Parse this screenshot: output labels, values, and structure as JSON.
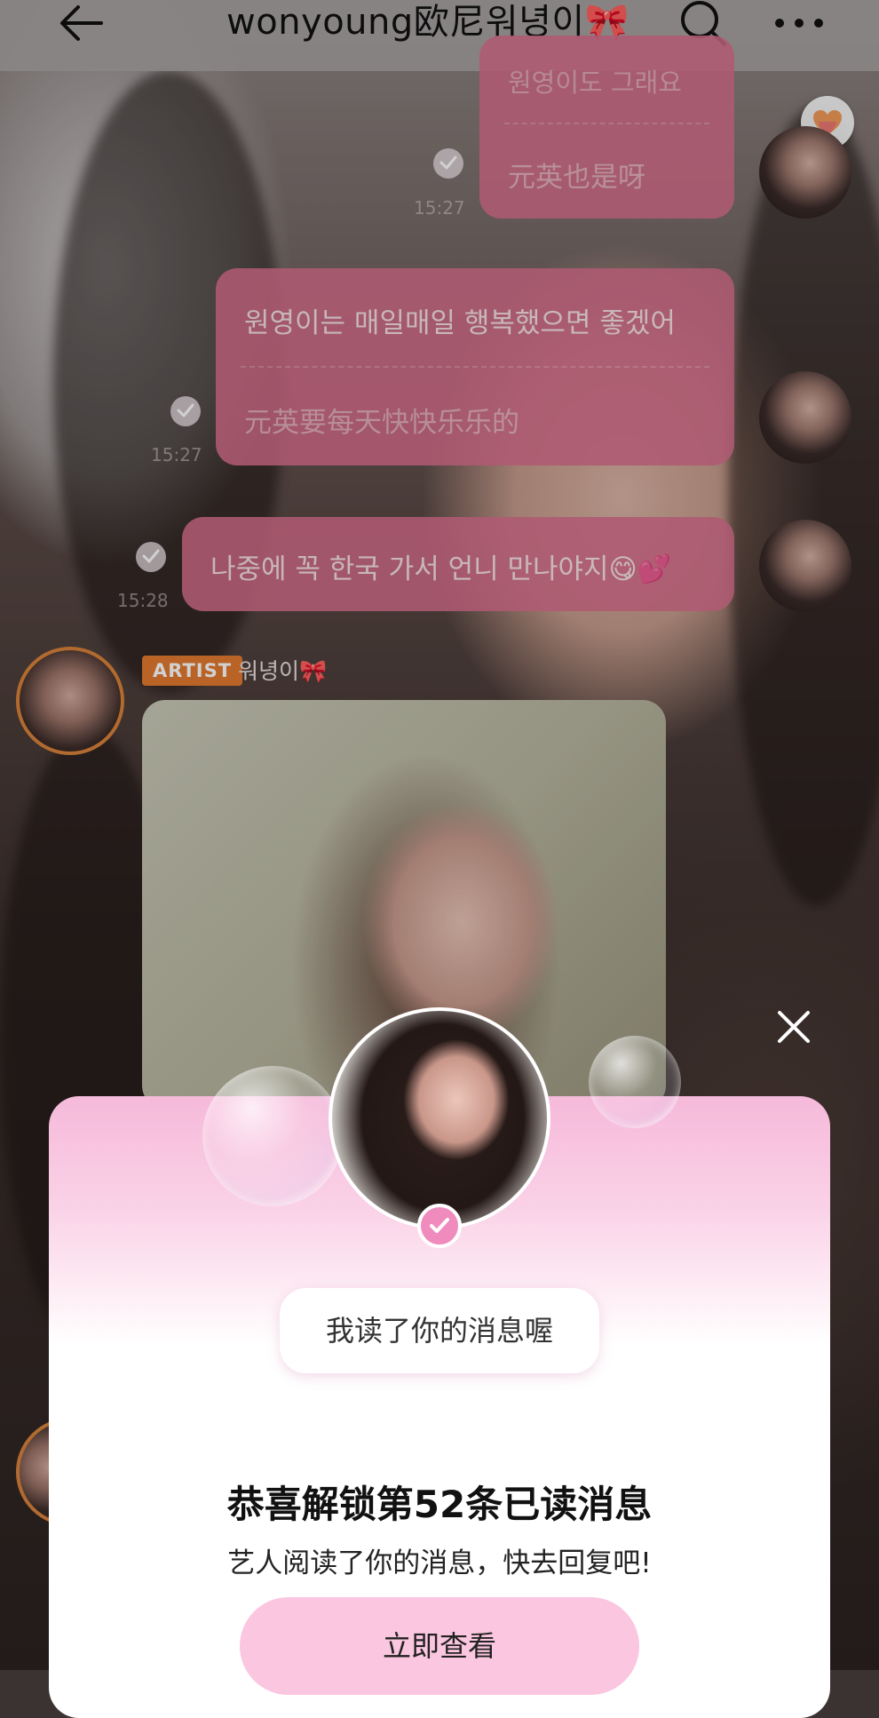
{
  "header": {
    "title": "wonyoung欧尼워녕이🎀",
    "back_icon": "back-arrow-icon",
    "search_icon": "search-icon",
    "more_icon": "more-dots-icon"
  },
  "messages": [
    {
      "partial_line": "원영이도 그래요",
      "translation": "元英也是呀",
      "time": "15:27"
    },
    {
      "text": "원영이는 매일매일 행복했으면 좋겠어",
      "translation": "元英要每天快快乐乐的",
      "time": "15:27"
    },
    {
      "text": "나중에 꼭 한국 가서 언니 만나야지😋💕",
      "time": "15:28"
    }
  ],
  "artist_post": {
    "badge": "ARTIST",
    "name": "워녕이🎀"
  },
  "modal": {
    "read_chip": "我读了你的消息喔",
    "title": "恭喜解锁第52条已读消息",
    "subtitle": "艺人阅读了你的消息，快去回复吧!",
    "button": "立即查看",
    "accent_color": "#f08cbd"
  },
  "colors": {
    "bubble": "#d66e8c",
    "artist_badge": "#e2792f",
    "button": "#fbc6df"
  }
}
